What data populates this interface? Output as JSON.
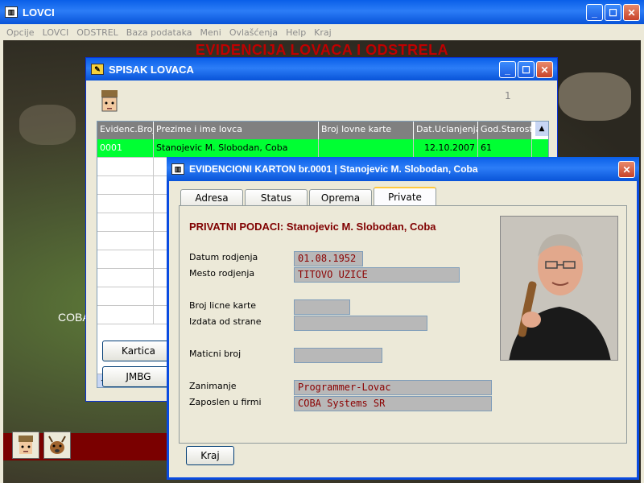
{
  "main_window": {
    "title": "LOVCI",
    "menu": [
      "Opcije",
      "LOVCI",
      "ODSTREL",
      "Baza podataka",
      "Meni",
      "Ovlašćenja",
      "Help",
      "Kraj"
    ],
    "heading": "EVIDENCIJA LOVACA I ODSTRELA",
    "background_label": "COBA"
  },
  "spisak": {
    "title": "SPISAK LOVACA",
    "counter": "1",
    "columns": [
      "Evidenc.Broj",
      "Prezime i ime lovca",
      "Broj lovne karte",
      "Dat.Uclanjenja",
      "God.Starosti"
    ],
    "rows": [
      {
        "evid": "0001",
        "ime": "Stanojevic M. Slobodan, Coba",
        "karta": "",
        "datum": "12.10.2007",
        "god": "61"
      }
    ],
    "btn_kartica": "Kartica",
    "btn_jmbg": "JMBG"
  },
  "karton": {
    "title": "EVIDENCIONI KARTON br.0001  |  Stanojevic M. Slobodan, Coba",
    "tabs": [
      "Adresa",
      "Status",
      "Oprema",
      "Private"
    ],
    "active_tab": "Private",
    "section_title": "PRIVATNI PODACI:  Stanojevic M. Slobodan, Coba",
    "fields": {
      "datum_rodjenja": {
        "label": "Datum rodjenja",
        "value": "01.08.1952"
      },
      "mesto_rodjenja": {
        "label": "Mesto rodjenja",
        "value": "TITOVO UZICE"
      },
      "broj_licne": {
        "label": "Broj licne karte",
        "value": ""
      },
      "izdata": {
        "label": "Izdata od strane",
        "value": ""
      },
      "maticni": {
        "label": "Maticni broj",
        "value": ""
      },
      "zanimanje": {
        "label": "Zanimanje",
        "value": "Programmer-Lovac"
      },
      "zaposlen": {
        "label": "Zaposlen u firmi",
        "value": "COBA Systems SR"
      }
    },
    "btn_kraj": "Kraj"
  },
  "colors": {
    "selected_row": "#00FF33",
    "heading": "#C00000",
    "field_text": "#8B0000"
  }
}
